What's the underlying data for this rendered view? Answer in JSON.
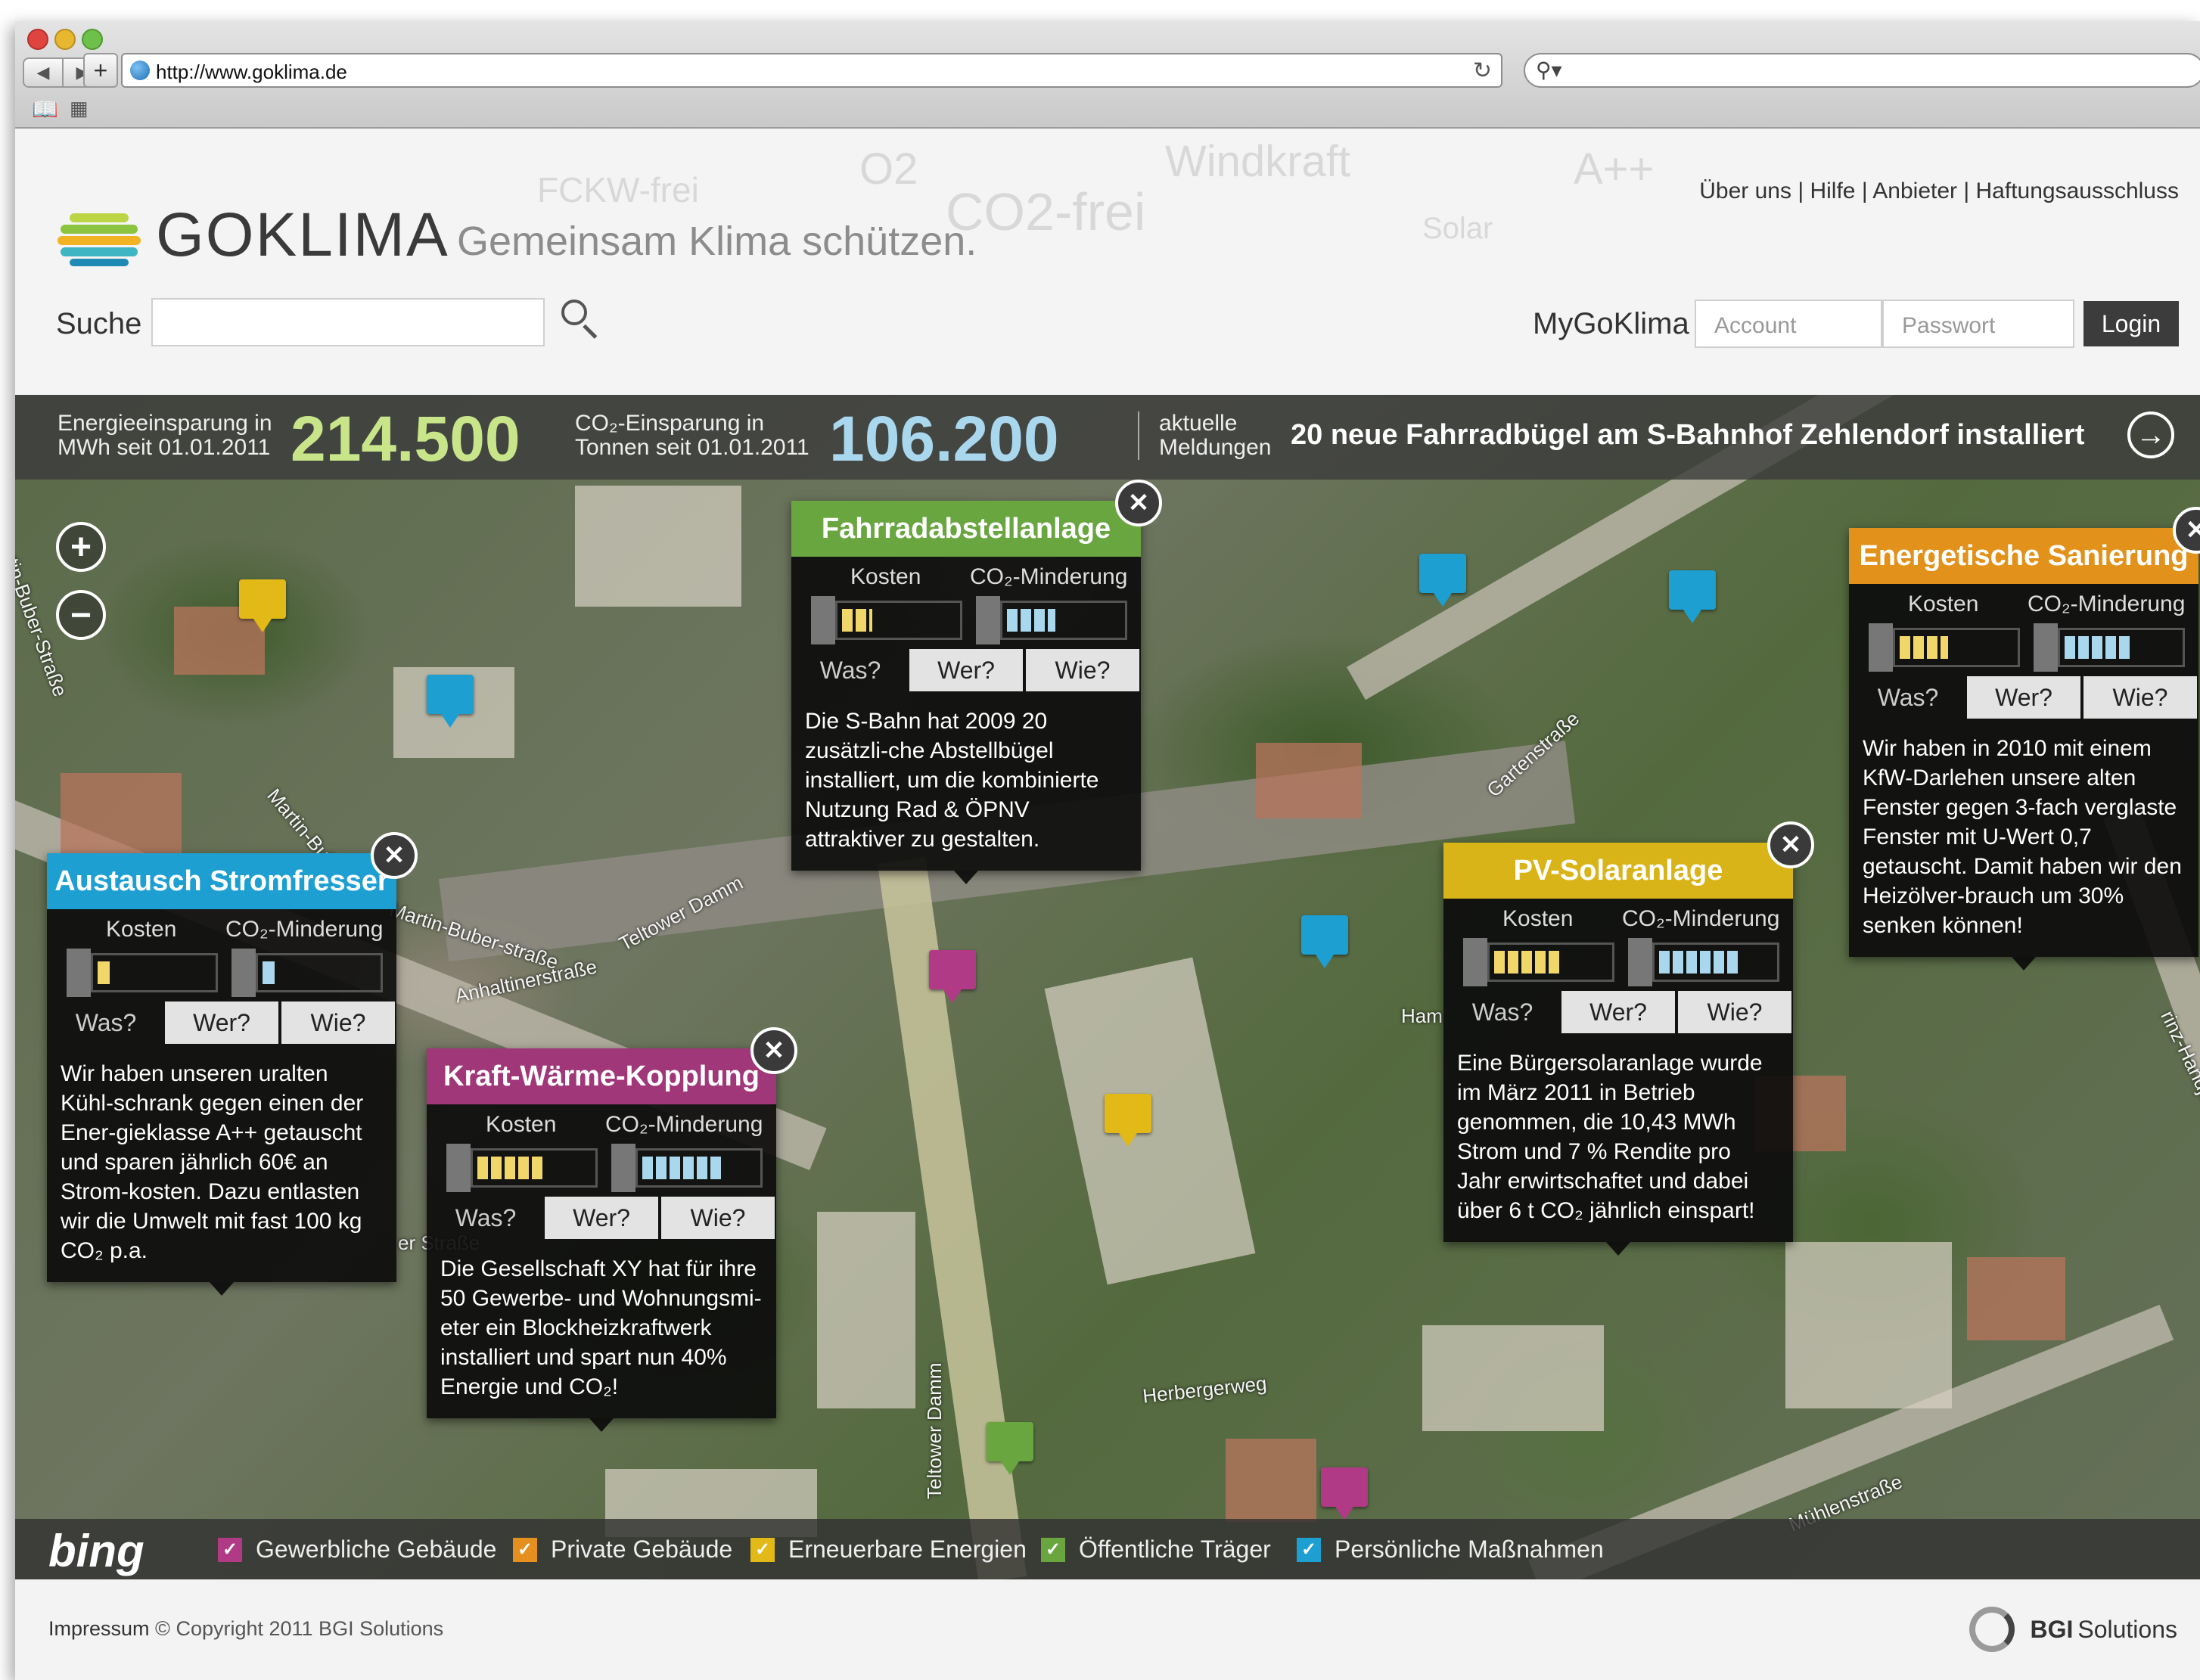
{
  "browser": {
    "url": "http://www.goklima.de",
    "search_icon": "magnifier-icon",
    "reload_icon": "reload-icon"
  },
  "header": {
    "ghost_words": [
      "FCKW-frei",
      "O2",
      "CO2-frei",
      "Windkraft",
      "A++",
      "Solar"
    ],
    "top_links": [
      "Über uns",
      "Hilfe",
      "Anbieter",
      "Haftungsausschluss"
    ],
    "logo_text": "GOKLIMA",
    "tagline": "Gemeinsam Klima schützen.",
    "search_label": "Suche",
    "search_value": "",
    "mygoklima_label": "MyGoKlima",
    "account_placeholder": "Account",
    "password_placeholder": "Passwort",
    "login_label": "Login"
  },
  "stats": {
    "energy_label_line1": "Energieeinsparung in",
    "energy_label_line2": "MWh seit 01.01.2011",
    "energy_value": "214.500",
    "co2_label_line1": "CO₂-Einsparung in",
    "co2_label_line2": "Tonnen seit 01.01.2011",
    "co2_value": "106.200",
    "news_label_line1": "aktuelle",
    "news_label_line2": "Meldungen",
    "news_text": "20 neue Fahrradbügel am S-Bahnhof Zehlendorf installiert",
    "energy_color": "#c9e58a",
    "co2_color": "#a9d8ee"
  },
  "streets": [
    "Martin-Buber-Straße",
    "Martin-Buber-",
    "Martin-Buber-straße",
    "Teltower Damm",
    "Anhaltinerstraße",
    "Gartenstraße",
    "Herbergerweg",
    "Teltower Damm",
    "Mühlenstraße",
    "Ham",
    "er Straße",
    "rinz-Handjery"
  ],
  "popups": [
    {
      "title": "Fahrradabstellanlage",
      "color": "#6aa640",
      "cost_label": "Kosten",
      "co2_label": "CO₂-Minderung",
      "cost_level": 0.25,
      "co2_level": 0.45,
      "tab_was": "Was?",
      "tab_wer": "Wer?",
      "tab_wie": "Wie?",
      "text": "Die S-Bahn hat 2009 20 zusätzli-che Abstellbügel installiert, um die kombinierte Nutzung Rad & ÖPNV attraktiver zu gestalten."
    },
    {
      "title": "Energetische Sanierung",
      "color": "#e2911b",
      "cost_label": "Kosten",
      "co2_label": "CO₂-Minderung",
      "cost_level": 0.45,
      "co2_level": 0.6,
      "tab_was": "Was?",
      "tab_wer": "Wer?",
      "tab_wie": "Wie?",
      "text": "Wir haben in 2010 mit einem KfW-Darlehen unsere alten Fenster gegen 3-fach verglaste Fenster mit U-Wert 0,7 getauscht. Damit haben wir den Heizölver-brauch um 30% senken können!"
    },
    {
      "title": "Austausch Stromfresser",
      "color": "#1e9fd2",
      "cost_label": "Kosten",
      "co2_label": "CO₂-Minderung",
      "cost_level": 0.1,
      "co2_level": 0.1,
      "tab_was": "Was?",
      "tab_wer": "Wer?",
      "tab_wie": "Wie?",
      "text": "Wir haben unseren uralten Kühl-schrank gegen einen der Ener-gieklasse A++ getauscht und sparen jährlich 60€ an Strom-kosten. Dazu entlasten wir die Umwelt mit fast 100 kg CO₂ p.a."
    },
    {
      "title": "Kraft-Wärme-Kopplung",
      "color": "#9f3778",
      "cost_label": "Kosten",
      "co2_label": "CO₂-Minderung",
      "cost_level": 0.6,
      "co2_level": 0.75,
      "tab_was": "Was?",
      "tab_wer": "Wer?",
      "tab_wie": "Wie?",
      "text": "Die Gesellschaft XY hat für ihre 50 Gewerbe- und Wohnungsmi-eter ein Blockheizkraftwerk installiert und spart nun 40% Energie und CO₂!"
    },
    {
      "title": "PV-Solaranlage",
      "color": "#d8b418",
      "cost_label": "Kosten",
      "co2_label": "CO₂-Minderung",
      "cost_level": 0.6,
      "co2_level": 0.75,
      "tab_was": "Was?",
      "tab_wer": "Wer?",
      "tab_wie": "Wie?",
      "text": "Eine Bürgersolaranlage wurde im März 2011 in Betrieb genommen, die 10,43 MWh Strom und 7 % Rendite pro Jahr erwirtschaftet und dabei über 6 t CO₂ jährlich einspart!"
    }
  ],
  "legend": {
    "provider": "bing",
    "items": [
      {
        "label": "Gewerbliche Gebäude",
        "color": "#b13a86",
        "checked": true
      },
      {
        "label": "Private Gebäude",
        "color": "#e48f1e",
        "checked": true
      },
      {
        "label": "Erneuerbare Energien",
        "color": "#e2b917",
        "checked": true
      },
      {
        "label": "Öffentliche Träger",
        "color": "#6aa640",
        "checked": true
      },
      {
        "label": "Persönliche Maßnahmen",
        "color": "#1e9fd2",
        "checked": true
      }
    ]
  },
  "footer": {
    "impressum": "Impressum",
    "copyright": "© Copyright 2011 BGI Solutions",
    "brand_bold": "BGI",
    "brand_light": "Solutions"
  }
}
